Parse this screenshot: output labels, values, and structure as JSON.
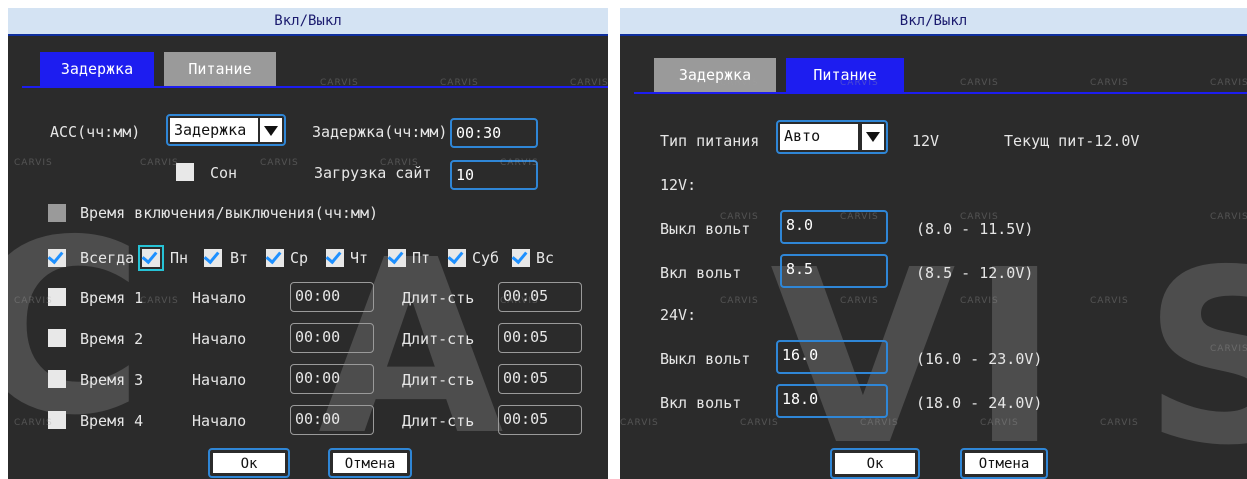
{
  "left": {
    "title": "Вкл/Выкл",
    "tabs": [
      {
        "label": "Задержка",
        "active": true
      },
      {
        "label": "Питание",
        "active": false
      }
    ],
    "acc_label": "ACC(чч:мм)",
    "acc_mode": "Задержка",
    "delay_label": "Задержка(чч:мм)",
    "delay_value": "00:30",
    "sleep_label": "Сон",
    "boot_label": "Загрузка сайт",
    "boot_value": "10",
    "onoff_label": "Время включения/выключения(чч:мм)",
    "days": [
      "Всегда",
      "Пн",
      "Вт",
      "Ср",
      "Чт",
      "Пт",
      "Суб",
      "Вс"
    ],
    "start_label": "Начало",
    "duration_label": "Длит-сть",
    "times": [
      {
        "label": "Время 1",
        "start": "00:00",
        "duration": "00:05"
      },
      {
        "label": "Время 2",
        "start": "00:00",
        "duration": "00:05"
      },
      {
        "label": "Время 3",
        "start": "00:00",
        "duration": "00:05"
      },
      {
        "label": "Время 4",
        "start": "00:00",
        "duration": "00:05"
      }
    ],
    "ok": "Ок",
    "cancel": "Отмена"
  },
  "right": {
    "title": "Вкл/Выкл",
    "tabs": [
      {
        "label": "Задержка",
        "active": false
      },
      {
        "label": "Питание",
        "active": true
      }
    ],
    "power_type_label": "Тип питания",
    "power_type": "Авто",
    "voltage": "12V",
    "current_power": "Текущ пит-12.0V",
    "v12_heading": "12V:",
    "v24_heading": "24V:",
    "off_label": "Выкл вольт",
    "on_label": "Вкл вольт",
    "v12_off": "8.0",
    "v12_off_range": "(8.0 - 11.5V)",
    "v12_on": "8.5",
    "v12_on_range": "(8.5 - 12.0V)",
    "v24_off": "16.0",
    "v24_off_range": "(16.0 - 23.0V)",
    "v24_on": "18.0",
    "v24_on_range": "(18.0 - 24.0V)",
    "ok": "Ок",
    "cancel": "Отмена"
  },
  "watermark": {
    "big": "CARVIS",
    "small": "CARVIS"
  },
  "colors": {
    "accent": "#1d1df0",
    "field_border": "#2f86d6",
    "background": "#2b2b2b",
    "titlebar": "#d4e3f3"
  }
}
